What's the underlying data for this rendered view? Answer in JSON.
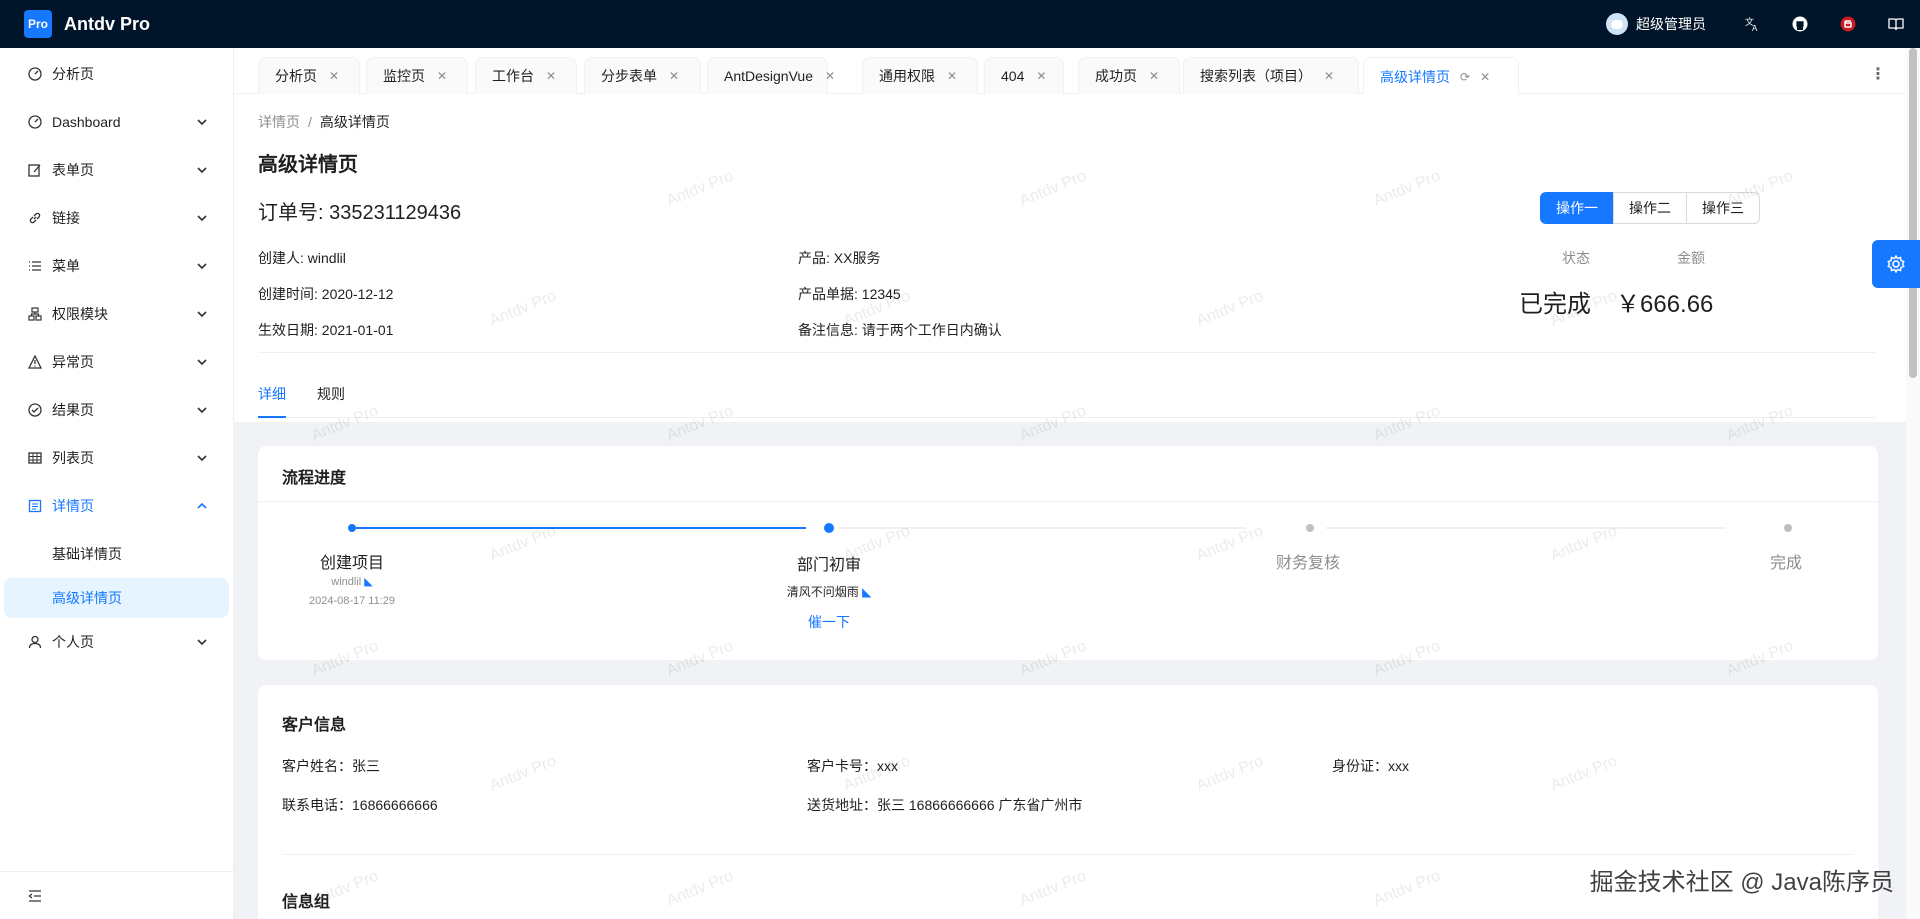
{
  "app": {
    "logo": "Pro",
    "title": "Antdv Pro"
  },
  "header": {
    "user": "超级管理员",
    "icons": [
      "translate-icon",
      "github-icon",
      "gitee-icon",
      "doc-icon"
    ]
  },
  "sidebar": {
    "items": [
      {
        "label": "分析页",
        "icon": "dashboard-icon"
      },
      {
        "label": "Dashboard",
        "icon": "dashboard-icon"
      },
      {
        "label": "表单页",
        "icon": "form-icon"
      },
      {
        "label": "链接",
        "icon": "link-icon"
      },
      {
        "label": "菜单",
        "icon": "menu-icon"
      },
      {
        "label": "权限模块",
        "icon": "cluster-icon"
      },
      {
        "label": "异常页",
        "icon": "warning-icon"
      },
      {
        "label": "结果页",
        "icon": "check-circle-icon"
      },
      {
        "label": "列表页",
        "icon": "table-icon"
      },
      {
        "label": "详情页",
        "icon": "profile-icon"
      },
      {
        "label": "个人页",
        "icon": "user-icon"
      }
    ],
    "sub": [
      "基础详情页",
      "高级详情页"
    ]
  },
  "tabs": [
    "分析页",
    "监控页",
    "工作台",
    "分步表单",
    "AntDesignVue",
    "通用权限",
    "404",
    "成功页",
    "搜索列表（项目）",
    "高级详情页"
  ],
  "breadcrumb": [
    "详情页",
    "高级详情页"
  ],
  "page": {
    "title": "高级详情页",
    "order": "订单号: 335231129436",
    "actions": [
      "操作一",
      "操作二",
      "操作三"
    ],
    "desc": [
      "创建人: windlil",
      "产品: XX服务",
      "创建时间: 2020-12-12",
      "产品单据: 12345",
      "生效日期: 2021-01-01",
      "备注信息: 请于两个工作日内确认"
    ],
    "status_label": "状态",
    "status_value": "已完成",
    "amount_label": "金额",
    "amount_value": "￥666.66",
    "tabs": [
      "详细",
      "规则"
    ]
  },
  "progress": {
    "title": "流程进度",
    "steps": [
      {
        "title": "创建项目",
        "sub1": "windlil",
        "sub2": "2024-08-17 11:29"
      },
      {
        "title": "部门初审",
        "sub1": "清风不问烟雨",
        "action": "催一下"
      },
      {
        "title": "财务复核"
      },
      {
        "title": "完成"
      }
    ]
  },
  "customer": {
    "title": "客户信息",
    "fields": [
      "客户姓名：张三",
      "客户卡号：xxx",
      "身份证：xxx",
      "联系电话：16866666666",
      "送货地址：张三 16866666666 广东省广州市"
    ],
    "group_title": "信息组"
  },
  "watermark": "Antdv Pro",
  "footer_mark": "掘金技术社区 @ Java陈序员",
  "colors": {
    "primary": "#1677ff",
    "header_bg": "#001529"
  }
}
